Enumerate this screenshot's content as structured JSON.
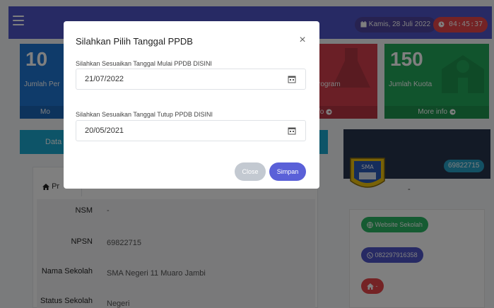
{
  "topbar": {
    "date": "Kamis, 28 Juli 2022",
    "clock": "04:45:37"
  },
  "cards": {
    "c1": {
      "value": "10",
      "label": "Jumlah Per",
      "foot": "Mo"
    },
    "c3": {
      "label": "rogram",
      "foot": "fo"
    },
    "c4": {
      "value": "150",
      "label": "Jumlah Kuota",
      "foot": "More info"
    }
  },
  "left_button": "Data",
  "tab_label": "Pr",
  "profile": {
    "rows": [
      {
        "label": "NSM",
        "value": "-"
      },
      {
        "label": "NPSN",
        "value": "69822715"
      },
      {
        "label": "Nama Sekolah",
        "value": "SMA Negeri 11 Muaro Jambi"
      },
      {
        "label": "Status Sekolah",
        "value": "Negeri"
      }
    ]
  },
  "sidebar": {
    "npsn_badge": "69822715",
    "logo_text": "SMA",
    "dash": "-",
    "website_label": "Website Sekolah",
    "whatsapp_label": "082297916358",
    "home_label": "-"
  },
  "modal": {
    "title": "Silahkan Pilih Tanggal PPDB",
    "start_label": "Silahkan Sesuaikan Tanggal Mulai PPDB DISINI",
    "start_value": "21/07/2022",
    "end_label": "Silahkan Sesuaikan Tanggal Tutup PPDB DISINI",
    "end_value": "20/05/2021",
    "close_label": "Close",
    "save_label": "Simpan"
  },
  "colors": {
    "primary": "#4f55c8",
    "danger": "#e9474b",
    "success": "#2ab764",
    "info": "#1aa9d1"
  }
}
